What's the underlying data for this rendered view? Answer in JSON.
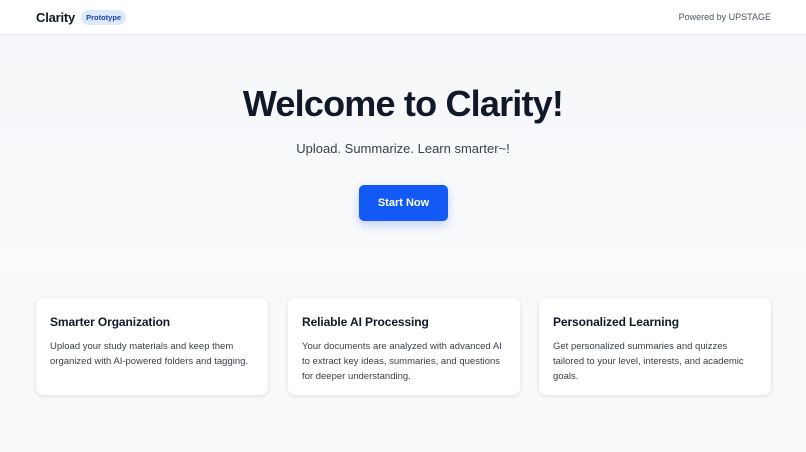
{
  "header": {
    "brand": "Clarity",
    "badge": "Prototype",
    "powered_by": "Powered by UPSTAGE"
  },
  "hero": {
    "title": "Welcome to Clarity!",
    "subtitle": "Upload. Summarize. Learn smarter~!",
    "cta_label": "Start Now"
  },
  "features": [
    {
      "title": "Smarter Organization",
      "body": "Upload your study materials and keep them organized with AI-powered folders and tagging."
    },
    {
      "title": "Reliable AI Processing",
      "body": "Your documents are analyzed with advanced AI to extract key ideas, summaries, and questions for deeper understanding."
    },
    {
      "title": "Personalized Learning",
      "body": "Get personalized summaries and quizzes tailored to your level, interests, and academic goals."
    }
  ],
  "colors": {
    "accent": "#1259f5",
    "badge_bg": "#dbeafe",
    "badge_text": "#1e40af"
  }
}
